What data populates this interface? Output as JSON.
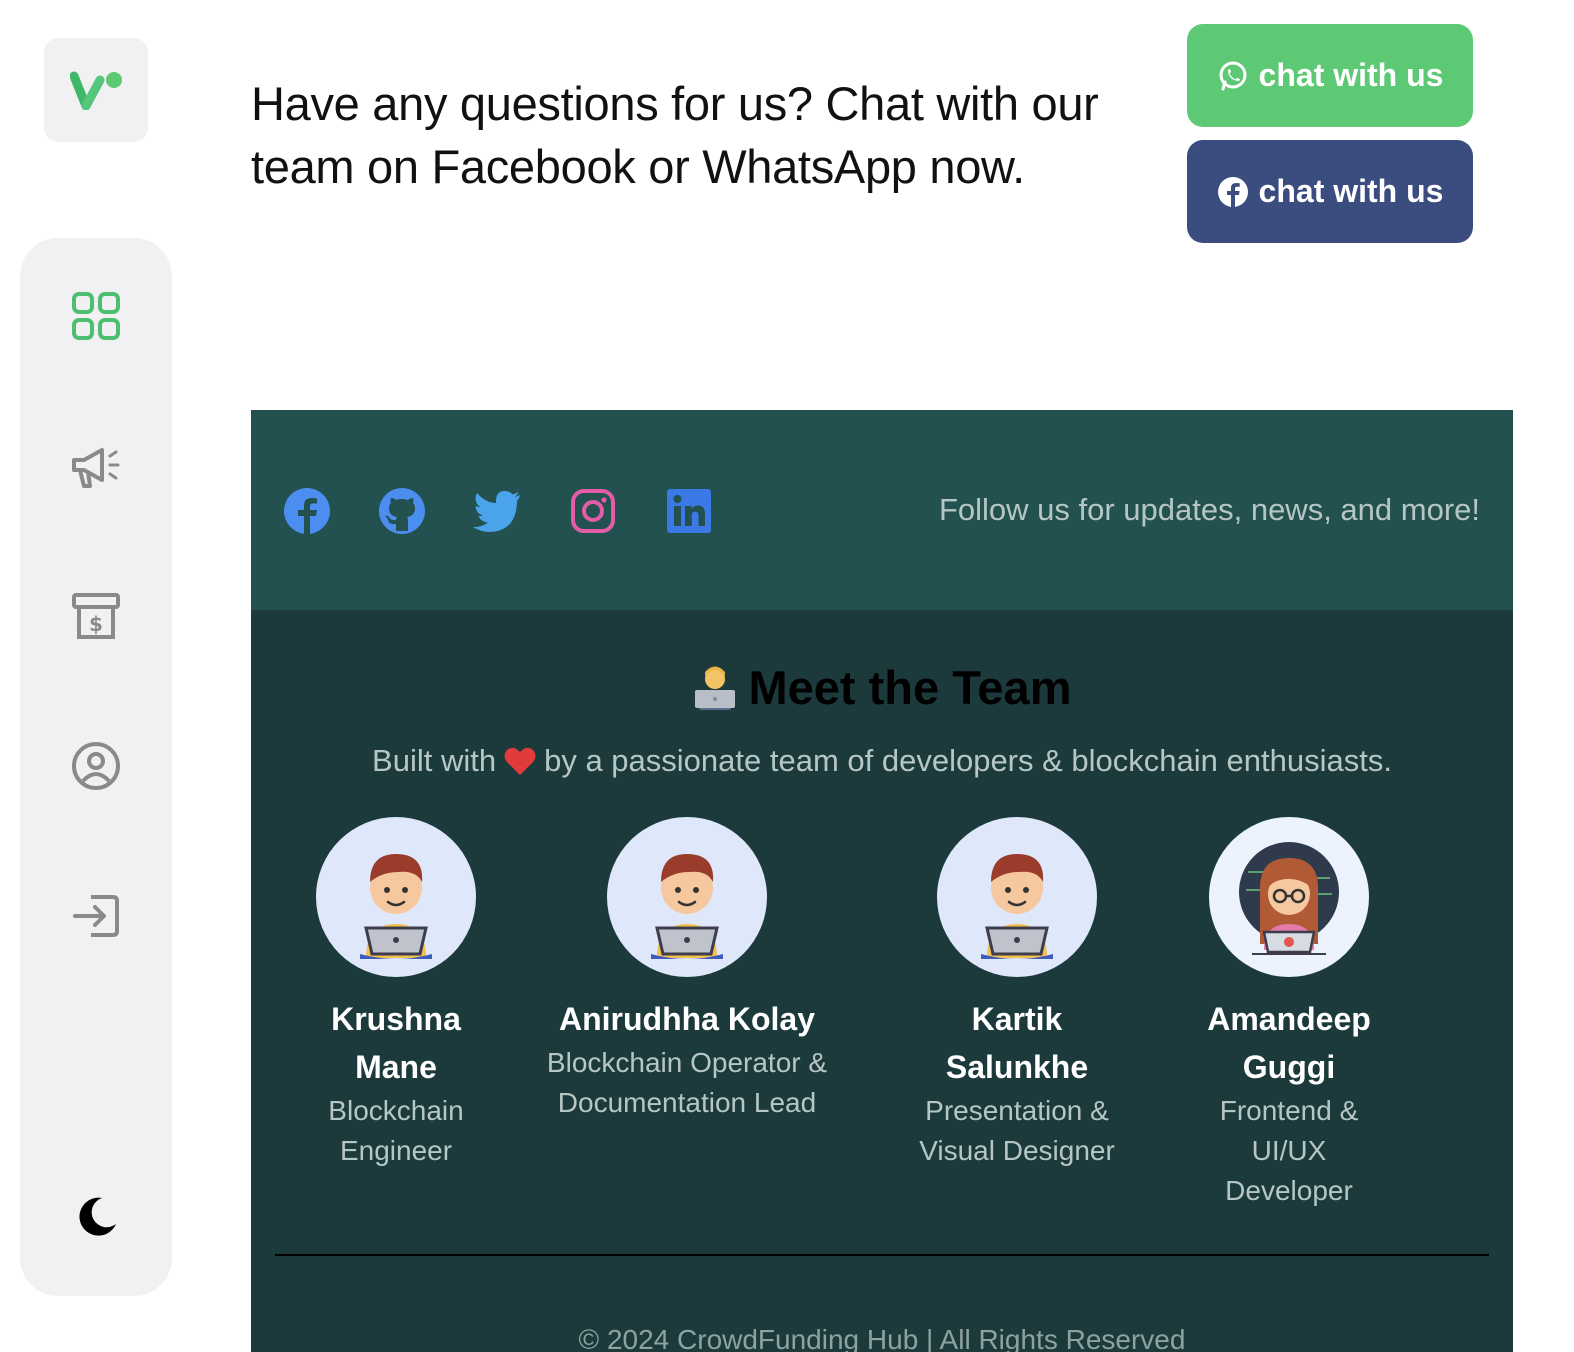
{
  "intro": {
    "text": "Have any questions for us? Chat with our team on Facebook or WhatsApp now."
  },
  "buttons": {
    "whatsapp_label": "chat with us",
    "facebook_label": "chat with us"
  },
  "colors": {
    "accent_green": "#5ec975",
    "facebook_blue": "#3b4c7f",
    "footer_dark": "#1c3a3c",
    "social_bar": "#225150"
  },
  "sidebar": {
    "logo_icon": "app-logo-icon",
    "items": [
      {
        "icon": "dashboard-grid-icon",
        "active": true
      },
      {
        "icon": "megaphone-icon",
        "active": false
      },
      {
        "icon": "dollar-box-icon",
        "active": false
      },
      {
        "icon": "user-circle-icon",
        "active": false
      },
      {
        "icon": "login-icon",
        "active": false
      }
    ],
    "theme_toggle_icon": "moon-icon"
  },
  "footer": {
    "social_icons": [
      "facebook-icon",
      "github-icon",
      "twitter-icon",
      "instagram-icon",
      "linkedin-icon"
    ],
    "follow_text": "Follow us for updates, news, and more!",
    "team_title": "Meet the Team",
    "team_subtitle_before": "Built with",
    "team_subtitle_after": "by a passionate team of developers & blockchain enthusiasts.",
    "members": [
      {
        "name": "Krushna Mane",
        "role": "Blockchain Engineer"
      },
      {
        "name": "Anirudhha Kolay",
        "role": "Blockchain Operator & Documentation Lead"
      },
      {
        "name": "Kartik Salunkhe",
        "role": "Presentation & Visual Designer"
      },
      {
        "name": "Amandeep Guggi",
        "role": "Frontend & UI/UX Developer"
      }
    ],
    "copyright": "© 2024 CrowdFunding Hub | All Rights Reserved"
  }
}
